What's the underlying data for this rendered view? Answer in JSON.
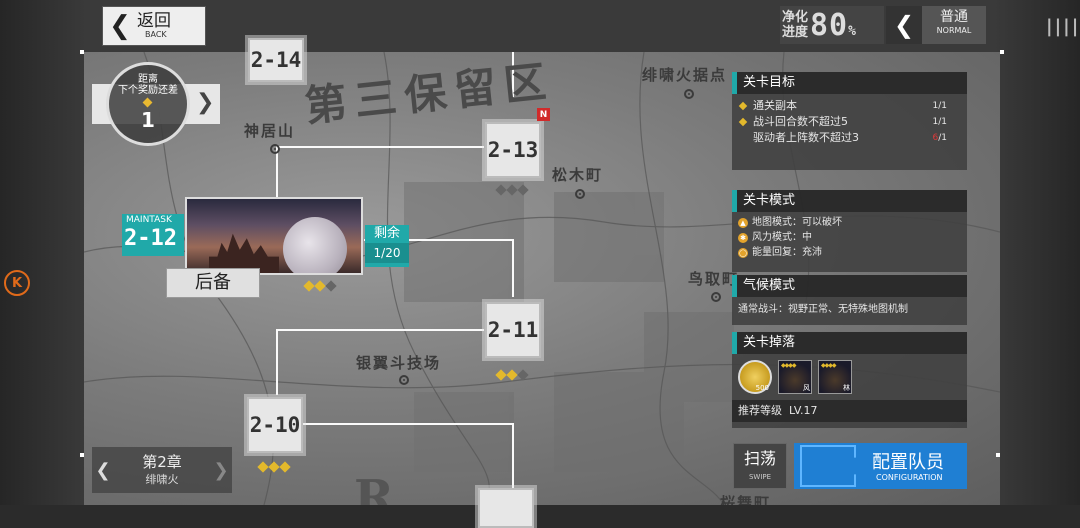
{
  "header": {
    "back_label": "返回",
    "back_sub": "BACK",
    "purify_label_1": "净化",
    "purify_label_2": "进度",
    "purify_value": "80",
    "purify_unit": "%",
    "difficulty_label": "普通",
    "difficulty_sub": "NORMAL",
    "menu_glyph": "||||"
  },
  "reward_tracker": {
    "line1": "距离",
    "line2": "下个奖励还差",
    "count": "1"
  },
  "map": {
    "region_name": "第三保留区",
    "places": [
      "绯啸火据点",
      "神居山",
      "松木町",
      "鸟取町",
      "银翼斗技场",
      "桜舞町"
    ],
    "bottom_text": "R"
  },
  "stages": [
    {
      "id": "2-14",
      "stars": 0,
      "new": false
    },
    {
      "id": "2-13",
      "stars": 0,
      "new": true,
      "new_label": "N"
    },
    {
      "id": "2-12",
      "stars": 2,
      "selected": true
    },
    {
      "id": "2-11",
      "stars": 2,
      "new": false
    },
    {
      "id": "2-10",
      "stars": 3,
      "new": false
    }
  ],
  "selected_stage": {
    "tag": "MAINTASK",
    "id": "2-12",
    "remain_label": "剩余",
    "remain_value": "1/20",
    "backup_label": "后备"
  },
  "chapter": {
    "title": "第2章",
    "name": "绯啸火"
  },
  "panel": {
    "objectives_title": "关卡目标",
    "objectives": [
      {
        "text": "通关副本",
        "progress": "1/1",
        "done": true,
        "fail_part": ""
      },
      {
        "text": "战斗回合数不超过5",
        "progress": "1/1",
        "done": true,
        "fail_part": ""
      },
      {
        "text": "驱动者上阵数不超过3",
        "progress_fail": "6",
        "progress_rest": "/1",
        "done": false
      }
    ],
    "mode_title": "关卡模式",
    "modes": [
      "地图模式：可以破坏",
      "风力模式：中",
      "能量回复：充沛"
    ],
    "weather_title": "气候模式",
    "weather_text": "通常战斗：视野正常、无特殊地图机制",
    "drops_title": "关卡掉落",
    "drops": [
      {
        "icon": "coin-icon",
        "tag": "500"
      },
      {
        "icon": "core-icon",
        "tag": "风"
      },
      {
        "icon": "core-icon",
        "tag": "林"
      }
    ],
    "level_label": "推荐等级",
    "level_value": "LV.17"
  },
  "actions": {
    "sweep_label": "扫荡",
    "sweep_sub": "SWIPE",
    "config_label": "配置队员",
    "config_sub": "CONFIGURATION"
  },
  "side": {
    "k_button": "K"
  },
  "colors": {
    "accent": "#20a9a9",
    "star": "#e3b92c",
    "config_blue": "#1f7fd3",
    "new_badge": "#d12a2a"
  }
}
